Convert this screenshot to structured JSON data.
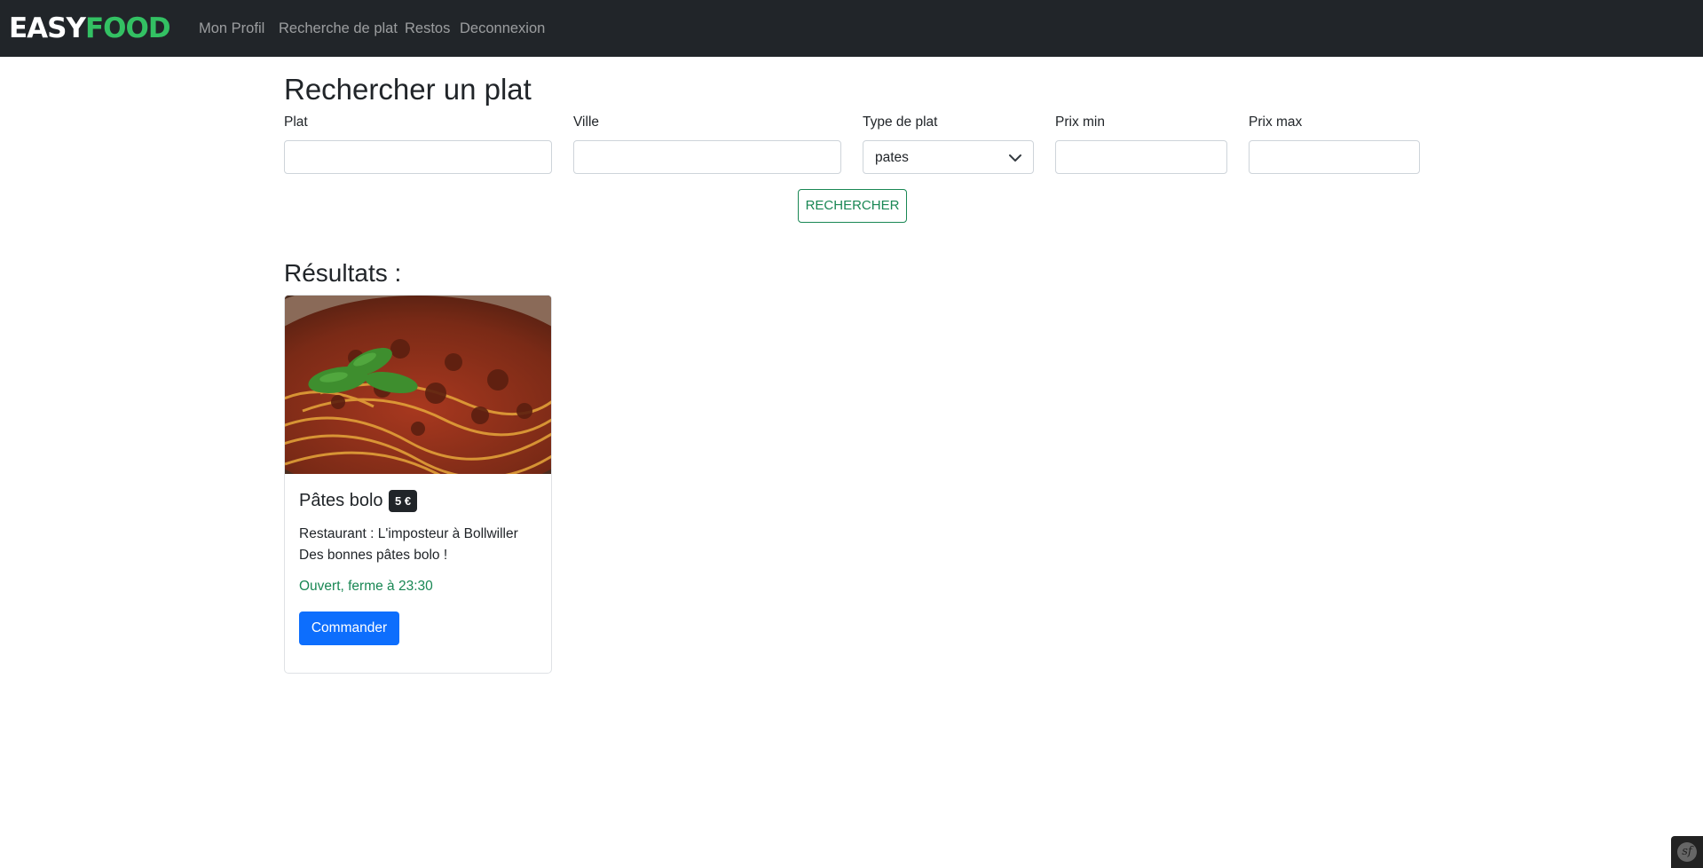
{
  "navbar": {
    "brand": {
      "part1": "EASY",
      "part2": "FOOD"
    },
    "links": [
      "Mon Profil",
      "Recherche de plat",
      "Restos",
      "Deconnexion"
    ]
  },
  "search": {
    "title": "Rechercher un plat",
    "fields": {
      "plat": {
        "label": "Plat",
        "value": ""
      },
      "ville": {
        "label": "Ville",
        "value": ""
      },
      "type": {
        "label": "Type de plat",
        "selected": "pates"
      },
      "prix_min": {
        "label": "Prix min",
        "value": ""
      },
      "prix_max": {
        "label": "Prix max",
        "value": ""
      }
    },
    "button": "RECHERCHER"
  },
  "results": {
    "title": "Résultats :",
    "items": [
      {
        "name": "Pâtes bolo",
        "price": "5 €",
        "restaurant": "Restaurant : L'imposteur à Bollwiller",
        "description": "Des bonnes pâtes bolo !",
        "status": "Ouvert, ferme à 23:30",
        "button": "Commander",
        "image_icon": "spaghetti-bolognese-photo"
      }
    ]
  },
  "colors": {
    "navbar_bg": "#212529",
    "brand_green": "#33c163",
    "success": "#198754",
    "primary": "#0d6efd"
  },
  "debug_toolbar": {
    "icon": "symfony-icon",
    "label": "sf"
  }
}
